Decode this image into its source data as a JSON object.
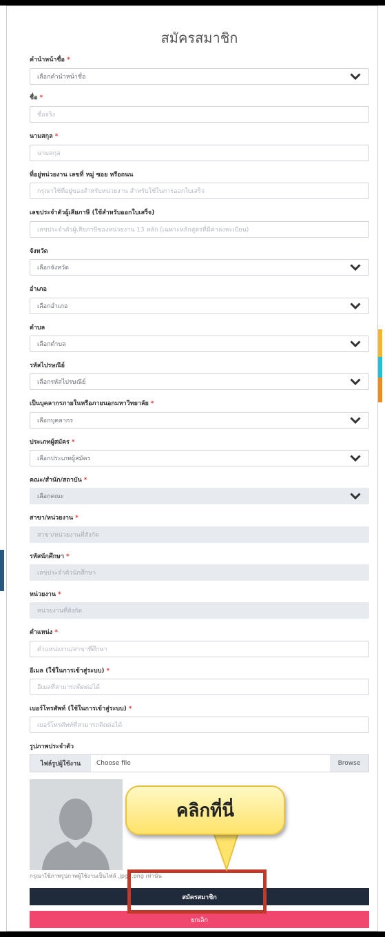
{
  "form": {
    "title": "สมัครสมาชิก",
    "fields": [
      {
        "label": "คำนำหน้าชื่อ",
        "required": true,
        "type": "select",
        "value": "เลือกคำนำหน้าชื่อ"
      },
      {
        "label": "ชื่อ",
        "required": true,
        "type": "text",
        "placeholder": "ชื่อจริง"
      },
      {
        "label": "นามสกุล",
        "required": true,
        "type": "text",
        "placeholder": "นามสกุล"
      },
      {
        "label": "ที่อยู่หน่วยงาน เลขที่ หมู่ ซอย หรือถนน",
        "required": false,
        "type": "text",
        "placeholder": "กรุณาใช้ที่อยู่ของสำหรับหน่วยงาน สำหรับใช้ในการออกใบเสร็จ"
      },
      {
        "label": "เลขประจำตัวผู้เสียภาษี (ใช้สำหรับออกใบเสร็จ)",
        "required": false,
        "type": "text",
        "placeholder": "เลขประจำตัวผู้เสียภาษีของหน่วยงาน 13 หลัก (เฉพาะหลักสูตรที่มีค่าลงทะเบียน)"
      },
      {
        "label": "จังหวัด",
        "required": false,
        "type": "select",
        "value": "เลือกจังหวัด"
      },
      {
        "label": "อำเภอ",
        "required": false,
        "type": "select",
        "value": "เลือกอำเภอ"
      },
      {
        "label": "ตำบล",
        "required": false,
        "type": "select",
        "value": "เลือกตำบล"
      },
      {
        "label": "รหัสไปรษณีย์",
        "required": false,
        "type": "select",
        "value": "เลือกรหัสไปรษณีย์"
      },
      {
        "label": "เป็นบุคลากรภายในหรือภายนอกมหาวิทยาลัย",
        "required": true,
        "type": "select",
        "value": "เลือกบุคลากร"
      },
      {
        "label": "ประเภทผู้สมัคร",
        "required": true,
        "type": "select",
        "value": "เลือกประเภทผู้สมัคร"
      },
      {
        "label": "คณะ/สำนัก/สถาบัน",
        "required": true,
        "type": "select-disabled",
        "value": "เลือกคณะ"
      },
      {
        "label": "สาขา/หน่วยงาน",
        "required": true,
        "type": "text-disabled",
        "placeholder": "สาขา/หน่วยงานที่สังกัด"
      },
      {
        "label": "รหัสนักศึกษา",
        "required": true,
        "type": "text-disabled",
        "placeholder": "เลขประจำตัวนักศึกษา"
      },
      {
        "label": "หน่วยงาน",
        "required": true,
        "type": "text-disabled",
        "placeholder": "หน่วยงานที่สังกัด"
      },
      {
        "label": "ตำแหน่ง",
        "required": true,
        "type": "text",
        "placeholder": "ตำแหน่งงาน/สาขาที่ศึกษา"
      },
      {
        "label": "อีเมล (ใช้ในการเข้าสู่ระบบ)",
        "required": true,
        "type": "text",
        "placeholder": "อีเมลที่สามารถติดต่อได้"
      },
      {
        "label": "เบอร์โทรศัพท์ (ใช้ในการเข้าสู่ระบบ)",
        "required": true,
        "type": "text",
        "placeholder": "เบอร์โทรศัพท์ที่สามารถติดต่อได้"
      }
    ],
    "photo": {
      "label": "รูปภาพประจำตัว",
      "prefix": "ไฟล์รูปผู้ใช้งาน",
      "file_text": "Choose file",
      "browse": "Browse",
      "hint": "กรุณาใช้ภาพรูปภาพผู้ใช้งานเป็นไฟล์ .jpg, .png เท่านั้น"
    },
    "submit_label": "สมัครสมาชิก",
    "cancel_label": "ยกเลิก"
  },
  "callout": {
    "text": "คลิกที่นี่"
  },
  "colors": {
    "submit": "#1f2a3a",
    "cancel": "#f1476e",
    "highlight": "#c0392b",
    "callout": "#ffe36a"
  }
}
